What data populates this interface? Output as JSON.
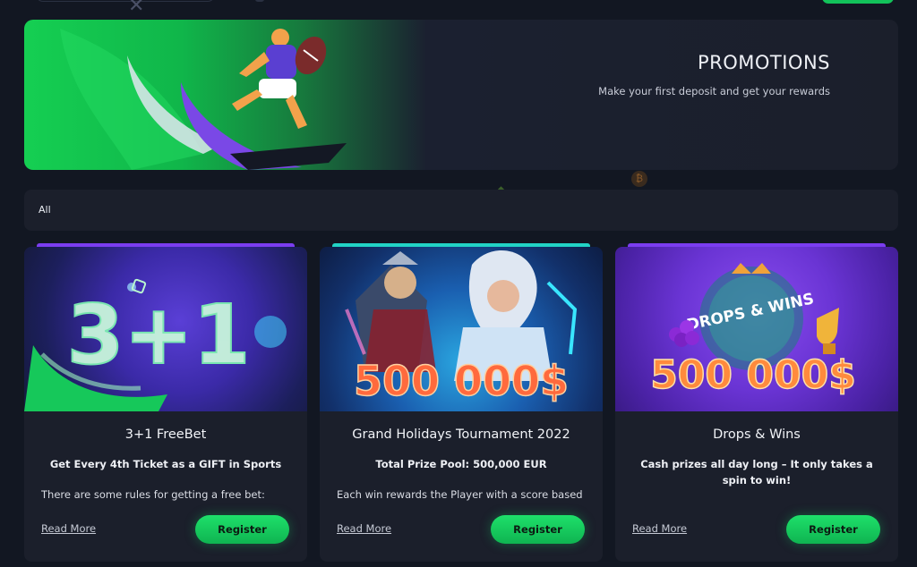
{
  "colors": {
    "background": "#121722",
    "panel": "#1b1f2b",
    "accent_green": "#14c95a",
    "card_accent_purple": "#7b3df0",
    "card_accent_cyan": "#22d3c5"
  },
  "header": {
    "close_icon": "close-icon"
  },
  "hero": {
    "title": "PROMOTIONS",
    "subtitle": "Make your first deposit and get your rewards"
  },
  "filter": {
    "all_label": "All"
  },
  "cards": [
    {
      "art_text": "3+1",
      "title": "3+1 FreeBet",
      "subtitle": "Get Every 4th Ticket as a GIFT in Sports",
      "description": "There are some rules for getting a free bet:",
      "read_more": "Read More",
      "register": "Register"
    },
    {
      "art_text": "500 000$",
      "title": "Grand Holidays Tournament 2022",
      "subtitle": "Total Prize Pool: 500,000 EUR",
      "description": "Each win rewards the Player with a score based",
      "read_more": "Read More",
      "register": "Register"
    },
    {
      "art_logo": "DROPS & WINS",
      "art_text": "500 000$",
      "title": "Drops & Wins",
      "subtitle": "Cash prizes all day long – It only takes a spin to win!",
      "description": "",
      "read_more": "Read More",
      "register": "Register"
    }
  ]
}
